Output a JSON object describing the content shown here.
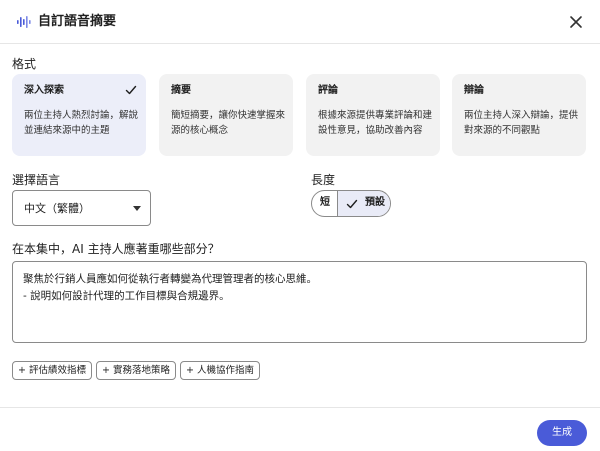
{
  "dialog": {
    "title": "自訂語音摘要",
    "logo_icon": "audio-waveform-icon",
    "close_icon": "close-icon"
  },
  "format": {
    "label": "格式",
    "cards": [
      {
        "title": "深入探索",
        "desc": "兩位主持人熱烈討論，解說並連結來源中的主題",
        "selected": true
      },
      {
        "title": "摘要",
        "desc": "簡短摘要，讓你快速掌握來源的核心概念",
        "selected": false
      },
      {
        "title": "評論",
        "desc": "根據來源提供專業評論和建設性意見，協助改善內容",
        "selected": false
      },
      {
        "title": "辯論",
        "desc": "兩位主持人深入辯論，提供對來源的不同觀點",
        "selected": false
      }
    ]
  },
  "language": {
    "label": "選擇語言",
    "value": "中文（繁體）"
  },
  "length": {
    "label": "長度",
    "options": [
      "短",
      "預設"
    ],
    "selected": "預設"
  },
  "focus": {
    "label": "在本集中，AI 主持人應著重哪些部分？",
    "lines": [
      "聚焦於行銷人員應如何從執行者轉變為代理管理者的核心思維。",
      "- 說明如何設計代理的工作目標與合規邊界。"
    ]
  },
  "chips": [
    "+ 評估績效指標",
    "+ 實務落地策略",
    "+ 人機協作指南"
  ],
  "footer": {
    "generate_label": "生成"
  },
  "colors": {
    "accent": "#4a5bd8",
    "selected_card": "#eceef9"
  }
}
